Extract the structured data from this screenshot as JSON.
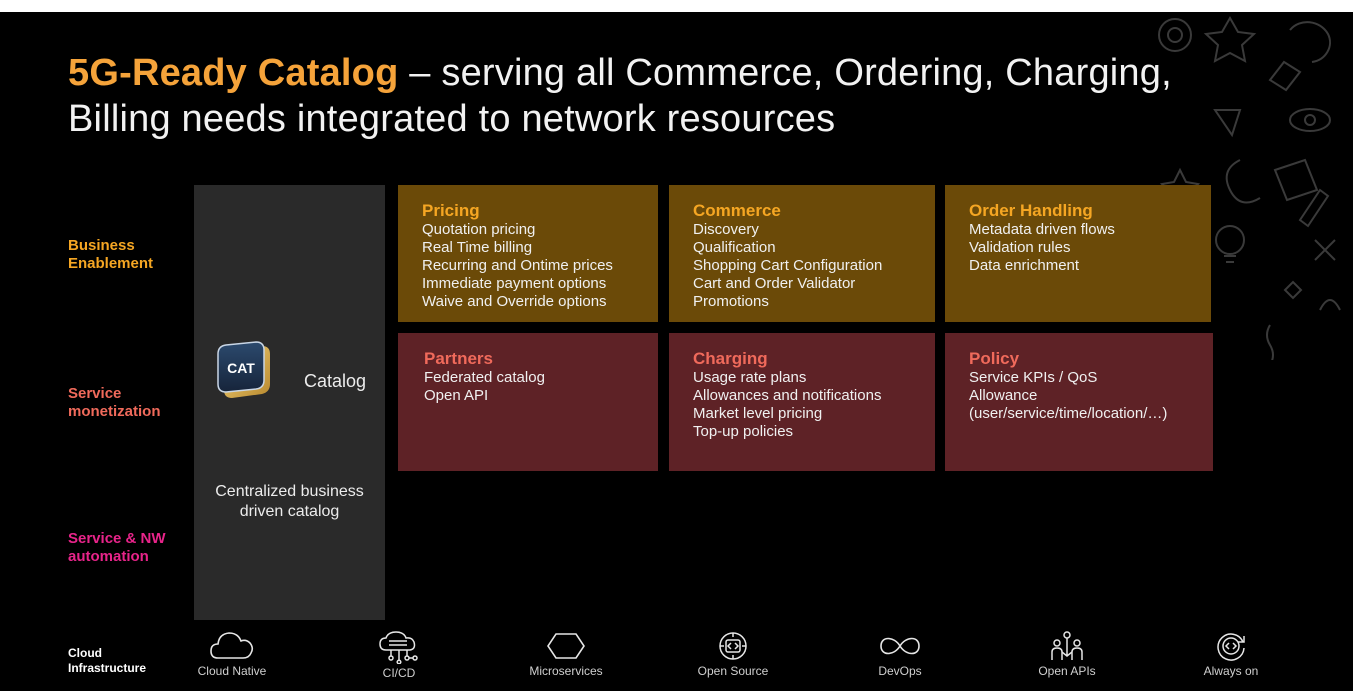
{
  "slide": {
    "title_accent": "5G-Ready Catalog",
    "title_rest": " – serving all Commerce, Ordering, Charging, Billing needs integrated to network resources"
  },
  "rows": {
    "business_enablement": "Business Enablement",
    "service_monetization": "Service monetization",
    "service_nw_automation": "Service & NW automation"
  },
  "catalog": {
    "badge_text": "CAT",
    "label": "Catalog",
    "description": "Centralized business driven catalog"
  },
  "boxes": {
    "pricing": {
      "title": "Pricing",
      "items": [
        "Quotation pricing",
        "Real Time billing",
        "Recurring and Ontime prices",
        "Immediate payment options",
        "Waive and Override options"
      ]
    },
    "commerce": {
      "title": "Commerce",
      "items": [
        "Discovery",
        "Qualification",
        "Shopping Cart Configuration",
        "Cart and Order Validator",
        "Promotions"
      ]
    },
    "order_handling": {
      "title": "Order Handling",
      "items": [
        "Metadata driven flows",
        "Validation rules",
        "Data enrichment"
      ]
    },
    "partners": {
      "title": "Partners",
      "items": [
        "Federated catalog",
        "Open API"
      ]
    },
    "charging": {
      "title": "Charging",
      "items": [
        "Usage rate plans",
        "Allowances and notifications",
        "Market level pricing",
        "Top-up policies"
      ]
    },
    "policy": {
      "title": "Policy",
      "items": [
        "Service KPIs / QoS",
        "Allowance",
        "(user/service/time/location/…)"
      ]
    }
  },
  "infrastructure": {
    "label": "Cloud Infrastructure",
    "items": [
      {
        "label": "Cloud Native",
        "icon": "cloud-icon"
      },
      {
        "label": "CI/CD",
        "icon": "cloud-pipeline-icon"
      },
      {
        "label": "Microservices",
        "icon": "hexagon-icon"
      },
      {
        "label": "Open Source",
        "icon": "code-chip-icon"
      },
      {
        "label": "DevOps",
        "icon": "infinity-icon"
      },
      {
        "label": "Open APIs",
        "icon": "people-network-icon"
      },
      {
        "label": "Always on",
        "icon": "refresh-code-icon"
      }
    ]
  },
  "colors": {
    "accent": "#f5a33a",
    "gold_box": "#6b4a08",
    "maroon_box": "#5e2226",
    "business": "#f5a623",
    "monetization": "#f06a5b",
    "automation": "#e8248a"
  }
}
